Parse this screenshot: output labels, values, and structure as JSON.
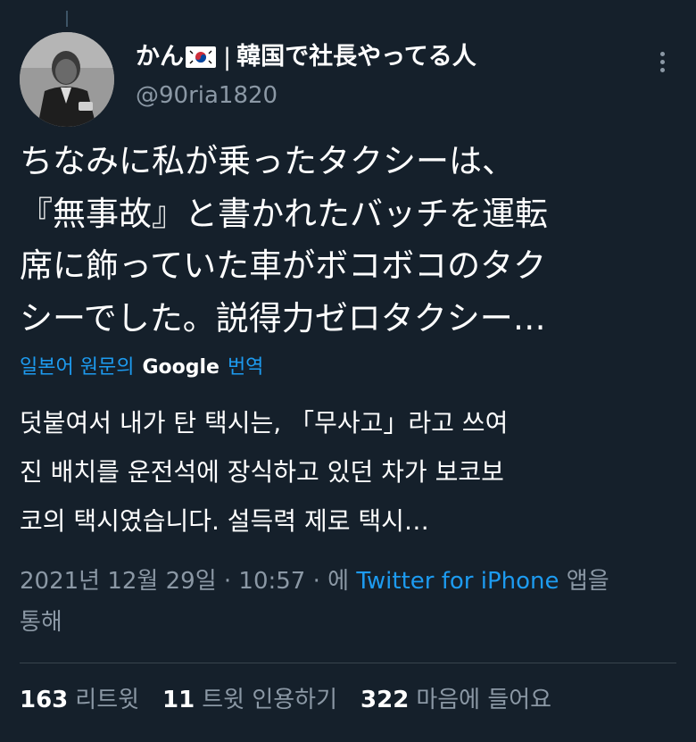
{
  "colors": {
    "background": "#15202b",
    "text_primary": "#ffffff",
    "text_secondary": "#8b98a5",
    "link": "#1d9bf0",
    "divider": "#38444d"
  },
  "author": {
    "name": "かん",
    "flag": "kr-flag-icon",
    "name_suffix": "韓国で社長やってる人",
    "separator": "|",
    "handle": "@90ria1820",
    "avatar": "avatar-photo"
  },
  "tweet": {
    "lines": [
      "ちなみに私が乗ったタクシーは、",
      "『無事故』と書かれたバッチを運転",
      "席に飾っていた車がボコボコのタク",
      "シーでした。説得力ゼロタクシー…"
    ]
  },
  "translation": {
    "prefix": "일본어 원문의",
    "google": "Google",
    "suffix": "번역",
    "lines": [
      "덧붙여서 내가 탄 택시는, 「무사고」라고 쓰여",
      "진 배치를 운전석에 장식하고 있던 차가 보코보",
      "코의 택시였습니다. 설득력 제로 택시…"
    ]
  },
  "meta": {
    "timestamp": "2021년 12월 29일 · 10:57 · 에",
    "source": "Twitter for iPhone",
    "source_suffix": "앱을",
    "source_suffix2": "통해"
  },
  "stats": [
    {
      "count": "163",
      "label": "리트윗"
    },
    {
      "count": "11",
      "label": "트윗 인용하기"
    },
    {
      "count": "322",
      "label": "마음에 들어요"
    }
  ]
}
